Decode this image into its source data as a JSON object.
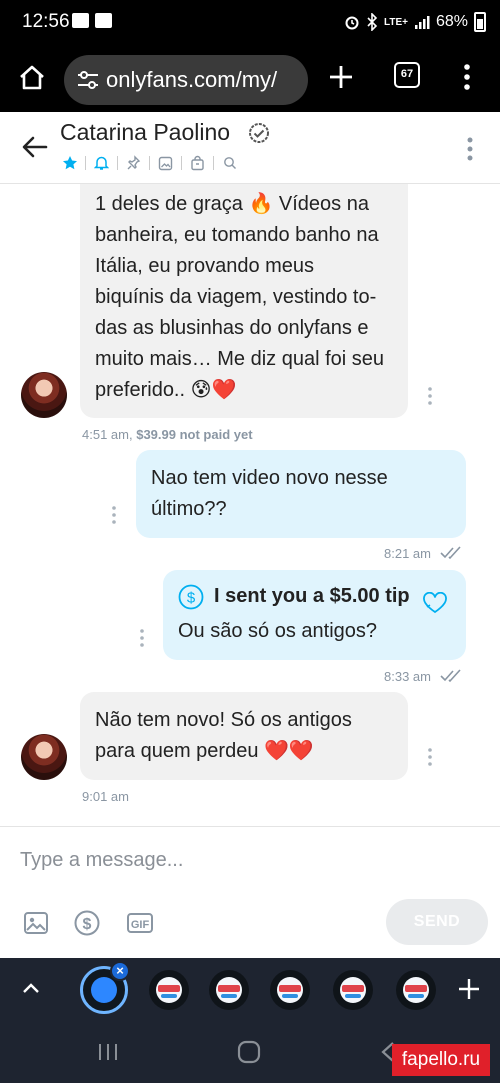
{
  "status_bar": {
    "time": "12:56",
    "network": "LTE+",
    "battery": "68%"
  },
  "browser": {
    "url": "onlyfans.com/my/",
    "tab_count": "67"
  },
  "chat_header": {
    "name": "Catarina Paolino"
  },
  "messages": [
    {
      "direction": "incoming",
      "text": "1 deles de graça 🔥 Vídeos na\nbanheira, eu tomando banho na\nItália, eu provando meus\nbiquínis da viagem, vestindo to-\ndas as blusinhas do onlyfans e\nmuito mais… Me diz qual foi seu\npreferido.. 😰❤️",
      "time": "4:51 am,",
      "price": "$39.99 not paid yet"
    },
    {
      "direction": "outgoing",
      "text": "Nao tem video novo nesse\núltimo??",
      "time": "8:21 am"
    },
    {
      "direction": "outgoing",
      "tip": "I sent you a $5.00 tip",
      "text": "Ou são só os antigos?",
      "time": "8:33 am"
    },
    {
      "direction": "incoming",
      "text": "Não tem novo! Só os antigos\npara quem perdeu ❤️❤️",
      "time": "9:01 am"
    }
  ],
  "composer": {
    "placeholder": "Type a message...",
    "send_label": "SEND"
  },
  "sticker_bar": {
    "close_label": "×"
  },
  "watermark": "fapello.ru",
  "colors": {
    "accent": "#00aff0",
    "outgoing_bubble": "#e0f4fd",
    "incoming_bubble": "#f1f1f1",
    "meta": "#8a96a3"
  }
}
